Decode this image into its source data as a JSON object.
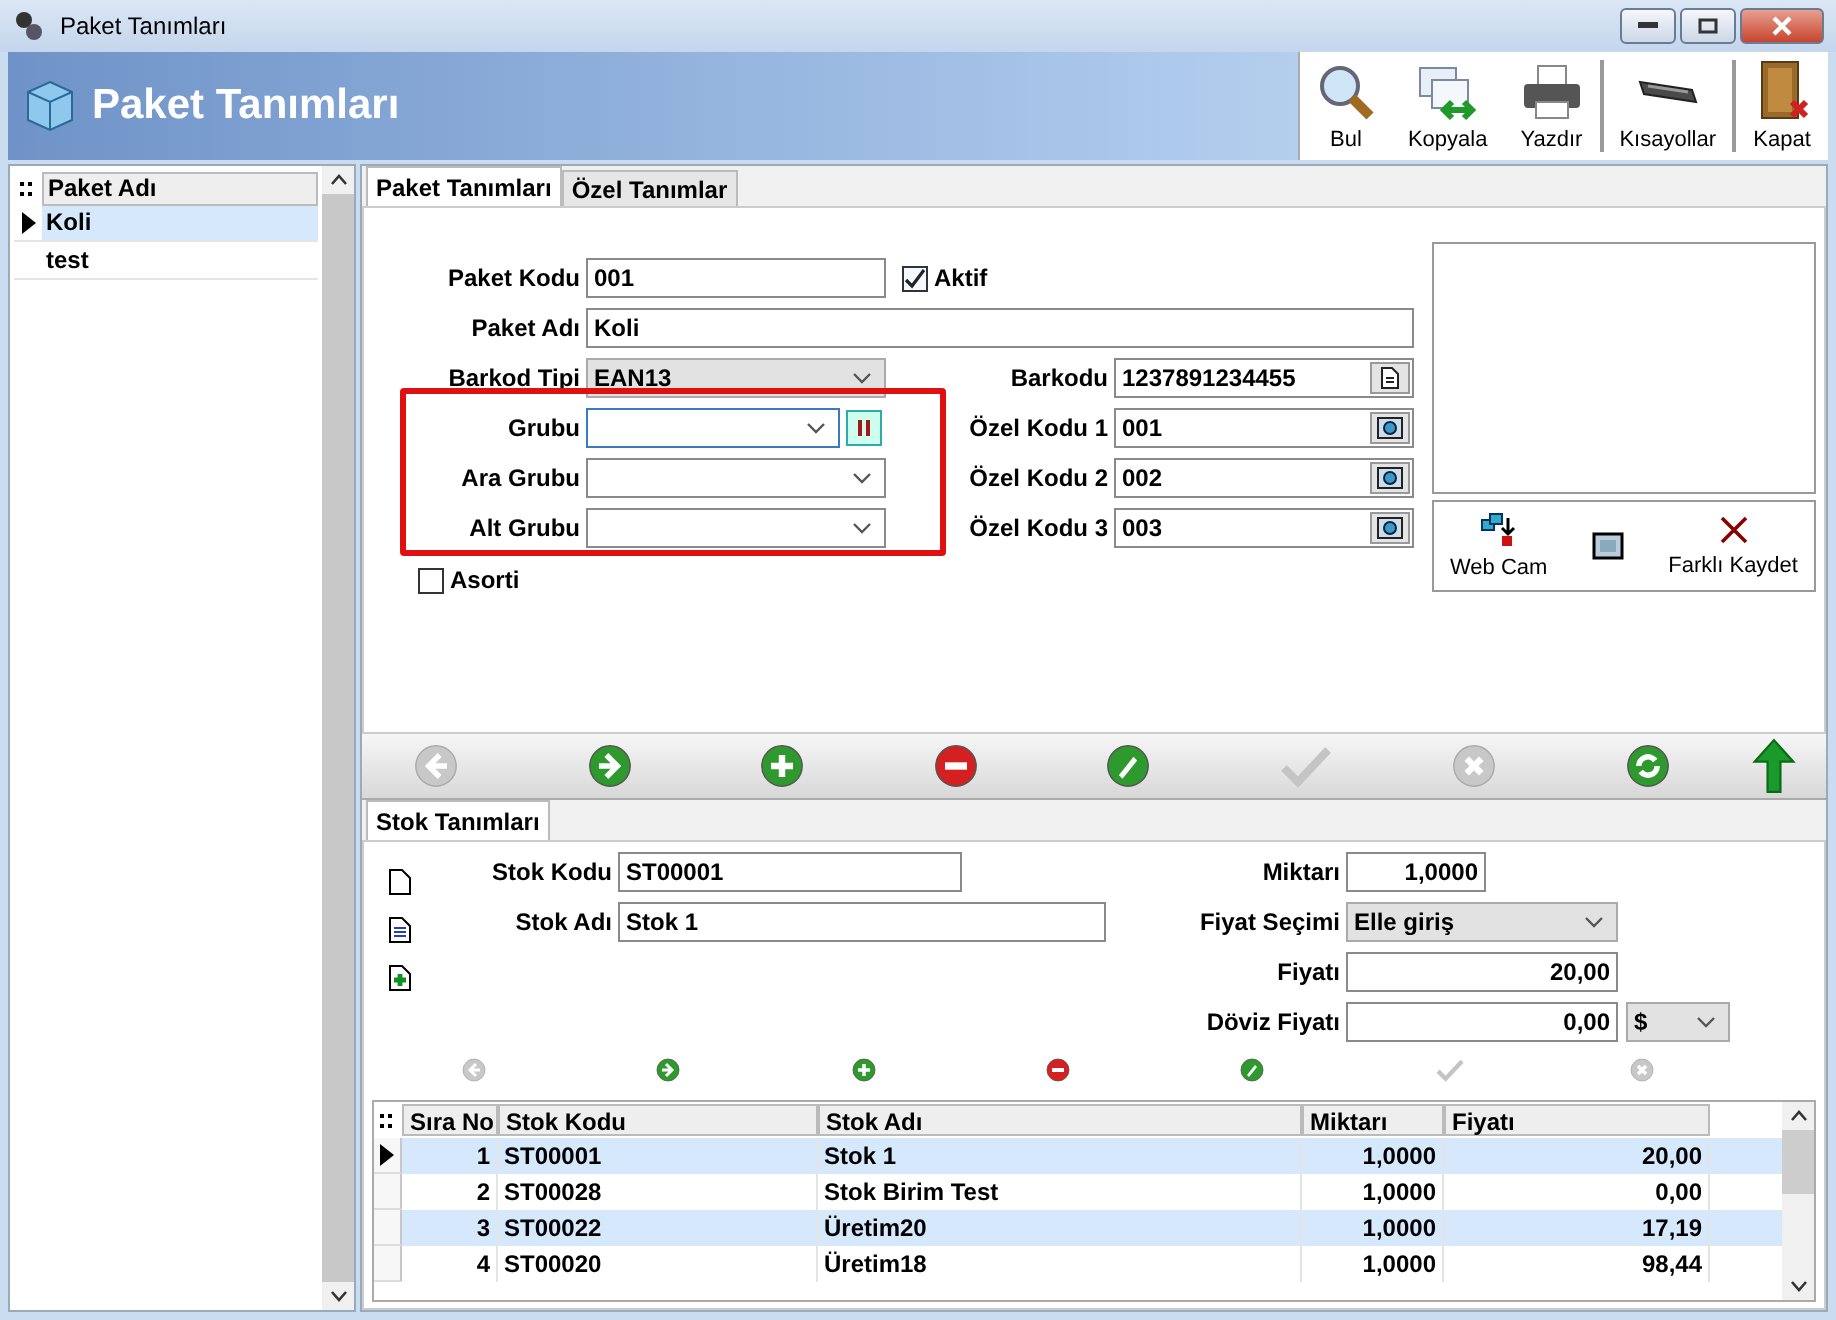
{
  "window": {
    "title": "Paket Tanımları"
  },
  "header": {
    "title": "Paket Tanımları",
    "tools": [
      {
        "kind": "search",
        "label": "Bul"
      },
      {
        "kind": "copy",
        "label": "Kopyala"
      },
      {
        "kind": "print",
        "label": "Yazdır"
      },
      {
        "kind": "keyboard",
        "label": "Kısayollar"
      },
      {
        "kind": "door",
        "label": "Kapat"
      }
    ]
  },
  "package_list": {
    "column": "Paket Adı",
    "rows": [
      {
        "name": "Koli",
        "selected": true
      },
      {
        "name": "test",
        "selected": false
      }
    ]
  },
  "tabs": [
    {
      "label": "Paket Tanımları",
      "selected": true
    },
    {
      "label": "Özel Tanımlar",
      "selected": false
    }
  ],
  "form": {
    "paket_kodu": {
      "label": "Paket Kodu",
      "value": "001"
    },
    "aktif": {
      "label": "Aktif",
      "checked": true
    },
    "paket_adi": {
      "label": "Paket Adı",
      "value": "Koli"
    },
    "barkod_tipi": {
      "label": "Barkod Tipi",
      "value": "EAN13",
      "disabled": true
    },
    "groups": [
      {
        "label": "Grubu",
        "focused": true
      },
      {
        "label": "Ara Grubu",
        "focused": false
      },
      {
        "label": "Alt Grubu",
        "focused": false
      }
    ],
    "codes": [
      {
        "label": "Barkodu",
        "value": "1237891234455",
        "kind": "barcode"
      },
      {
        "label": "Özel Kodu 1",
        "value": "001",
        "kind": "lookup"
      },
      {
        "label": "Özel Kodu 2",
        "value": "002",
        "kind": "lookup"
      },
      {
        "label": "Özel Kodu 3",
        "value": "003",
        "kind": "lookup"
      }
    ],
    "asorti": {
      "label": "Asorti",
      "checked": false
    }
  },
  "image_panel": {
    "buttons": [
      {
        "kind": "webcam",
        "label": "Web Cam"
      },
      {
        "kind": "screen"
      },
      {
        "kind": "delete",
        "label": "Farklı Kaydet"
      }
    ]
  },
  "nav": [
    {
      "kind": "prev",
      "disabled": true
    },
    {
      "kind": "next",
      "disabled": false
    },
    {
      "kind": "add",
      "disabled": false
    },
    {
      "kind": "remove",
      "disabled": false
    },
    {
      "kind": "edit",
      "disabled": false
    },
    {
      "kind": "confirm",
      "disabled": true
    },
    {
      "kind": "cancel",
      "disabled": true
    },
    {
      "kind": "refresh",
      "disabled": false
    },
    {
      "kind": "up",
      "disabled": false
    }
  ],
  "stock_tab": {
    "label": "Stok Tanımları"
  },
  "stock_form": {
    "side_icons": [
      {
        "kind": "new"
      },
      {
        "kind": "list"
      },
      {
        "kind": "add"
      }
    ],
    "stok_kodu": {
      "label": "Stok Kodu",
      "value": "ST00001"
    },
    "stok_adi": {
      "label": "Stok Adı",
      "value": "Stok 1"
    },
    "miktari": {
      "label": "Miktarı",
      "value": "1,0000"
    },
    "fiyat_secimi": {
      "label": "Fiyat Seçimi",
      "value": "Elle giriş"
    },
    "fiyati": {
      "label": "Fiyatı",
      "value": "20,00"
    },
    "doviz_fiyati": {
      "label": "Döviz Fiyatı",
      "value": "0,00",
      "currency": "$"
    }
  },
  "stock_nav": [
    {
      "kind": "prev",
      "disabled": true
    },
    {
      "kind": "next",
      "disabled": false
    },
    {
      "kind": "add",
      "disabled": false
    },
    {
      "kind": "remove",
      "disabled": false
    },
    {
      "kind": "edit",
      "disabled": false
    },
    {
      "kind": "confirm",
      "disabled": true
    },
    {
      "kind": "cancel",
      "disabled": true
    }
  ],
  "table": {
    "columns": [
      "Sıra No",
      "Stok Kodu",
      "Stok Adı",
      "Miktarı",
      "Fiyatı"
    ],
    "rows": [
      {
        "cells": [
          "1",
          "ST00001",
          "Stok 1",
          "1,0000",
          "20,00"
        ],
        "selected": true
      },
      {
        "cells": [
          "2",
          "ST00028",
          "Stok Birim Test",
          "1,0000",
          "0,00"
        ],
        "selected": false
      },
      {
        "cells": [
          "3",
          "ST00022",
          "Üretim20",
          "1,0000",
          "17,19"
        ],
        "selected": false
      },
      {
        "cells": [
          "4",
          "ST00020",
          "Üretim18",
          "1,0000",
          "98,44"
        ],
        "selected": false
      }
    ]
  }
}
